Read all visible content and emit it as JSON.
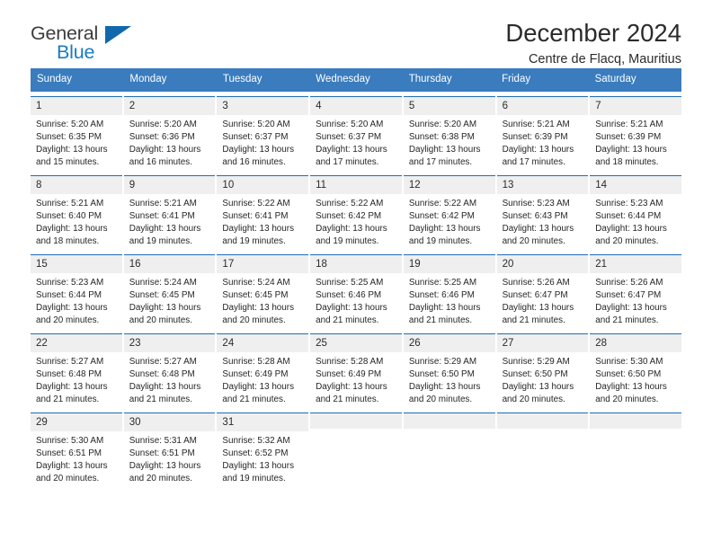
{
  "logo": {
    "word_one": "General",
    "word_two": "Blue",
    "icon": "triangle-mark"
  },
  "header": {
    "title": "December 2024",
    "subtitle": "Centre de Flacq, Mauritius"
  },
  "colors": {
    "header_band": "#3a7cbe",
    "cell_top_border": "#1f6db5",
    "day_number_bg": "#efefef",
    "logo_blue": "#1a7cc0",
    "text": "#262626"
  },
  "calendar": {
    "weekday_headers": [
      "Sunday",
      "Monday",
      "Tuesday",
      "Wednesday",
      "Thursday",
      "Friday",
      "Saturday"
    ],
    "weeks": [
      [
        {
          "day": "1",
          "lines": [
            "Sunrise: 5:20 AM",
            "Sunset: 6:35 PM",
            "Daylight: 13 hours",
            "and 15 minutes."
          ]
        },
        {
          "day": "2",
          "lines": [
            "Sunrise: 5:20 AM",
            "Sunset: 6:36 PM",
            "Daylight: 13 hours",
            "and 16 minutes."
          ]
        },
        {
          "day": "3",
          "lines": [
            "Sunrise: 5:20 AM",
            "Sunset: 6:37 PM",
            "Daylight: 13 hours",
            "and 16 minutes."
          ]
        },
        {
          "day": "4",
          "lines": [
            "Sunrise: 5:20 AM",
            "Sunset: 6:37 PM",
            "Daylight: 13 hours",
            "and 17 minutes."
          ]
        },
        {
          "day": "5",
          "lines": [
            "Sunrise: 5:20 AM",
            "Sunset: 6:38 PM",
            "Daylight: 13 hours",
            "and 17 minutes."
          ]
        },
        {
          "day": "6",
          "lines": [
            "Sunrise: 5:21 AM",
            "Sunset: 6:39 PM",
            "Daylight: 13 hours",
            "and 17 minutes."
          ]
        },
        {
          "day": "7",
          "lines": [
            "Sunrise: 5:21 AM",
            "Sunset: 6:39 PM",
            "Daylight: 13 hours",
            "and 18 minutes."
          ]
        }
      ],
      [
        {
          "day": "8",
          "lines": [
            "Sunrise: 5:21 AM",
            "Sunset: 6:40 PM",
            "Daylight: 13 hours",
            "and 18 minutes."
          ]
        },
        {
          "day": "9",
          "lines": [
            "Sunrise: 5:21 AM",
            "Sunset: 6:41 PM",
            "Daylight: 13 hours",
            "and 19 minutes."
          ]
        },
        {
          "day": "10",
          "lines": [
            "Sunrise: 5:22 AM",
            "Sunset: 6:41 PM",
            "Daylight: 13 hours",
            "and 19 minutes."
          ]
        },
        {
          "day": "11",
          "lines": [
            "Sunrise: 5:22 AM",
            "Sunset: 6:42 PM",
            "Daylight: 13 hours",
            "and 19 minutes."
          ]
        },
        {
          "day": "12",
          "lines": [
            "Sunrise: 5:22 AM",
            "Sunset: 6:42 PM",
            "Daylight: 13 hours",
            "and 19 minutes."
          ]
        },
        {
          "day": "13",
          "lines": [
            "Sunrise: 5:23 AM",
            "Sunset: 6:43 PM",
            "Daylight: 13 hours",
            "and 20 minutes."
          ]
        },
        {
          "day": "14",
          "lines": [
            "Sunrise: 5:23 AM",
            "Sunset: 6:44 PM",
            "Daylight: 13 hours",
            "and 20 minutes."
          ]
        }
      ],
      [
        {
          "day": "15",
          "lines": [
            "Sunrise: 5:23 AM",
            "Sunset: 6:44 PM",
            "Daylight: 13 hours",
            "and 20 minutes."
          ]
        },
        {
          "day": "16",
          "lines": [
            "Sunrise: 5:24 AM",
            "Sunset: 6:45 PM",
            "Daylight: 13 hours",
            "and 20 minutes."
          ]
        },
        {
          "day": "17",
          "lines": [
            "Sunrise: 5:24 AM",
            "Sunset: 6:45 PM",
            "Daylight: 13 hours",
            "and 20 minutes."
          ]
        },
        {
          "day": "18",
          "lines": [
            "Sunrise: 5:25 AM",
            "Sunset: 6:46 PM",
            "Daylight: 13 hours",
            "and 21 minutes."
          ]
        },
        {
          "day": "19",
          "lines": [
            "Sunrise: 5:25 AM",
            "Sunset: 6:46 PM",
            "Daylight: 13 hours",
            "and 21 minutes."
          ]
        },
        {
          "day": "20",
          "lines": [
            "Sunrise: 5:26 AM",
            "Sunset: 6:47 PM",
            "Daylight: 13 hours",
            "and 21 minutes."
          ]
        },
        {
          "day": "21",
          "lines": [
            "Sunrise: 5:26 AM",
            "Sunset: 6:47 PM",
            "Daylight: 13 hours",
            "and 21 minutes."
          ]
        }
      ],
      [
        {
          "day": "22",
          "lines": [
            "Sunrise: 5:27 AM",
            "Sunset: 6:48 PM",
            "Daylight: 13 hours",
            "and 21 minutes."
          ]
        },
        {
          "day": "23",
          "lines": [
            "Sunrise: 5:27 AM",
            "Sunset: 6:48 PM",
            "Daylight: 13 hours",
            "and 21 minutes."
          ]
        },
        {
          "day": "24",
          "lines": [
            "Sunrise: 5:28 AM",
            "Sunset: 6:49 PM",
            "Daylight: 13 hours",
            "and 21 minutes."
          ]
        },
        {
          "day": "25",
          "lines": [
            "Sunrise: 5:28 AM",
            "Sunset: 6:49 PM",
            "Daylight: 13 hours",
            "and 21 minutes."
          ]
        },
        {
          "day": "26",
          "lines": [
            "Sunrise: 5:29 AM",
            "Sunset: 6:50 PM",
            "Daylight: 13 hours",
            "and 20 minutes."
          ]
        },
        {
          "day": "27",
          "lines": [
            "Sunrise: 5:29 AM",
            "Sunset: 6:50 PM",
            "Daylight: 13 hours",
            "and 20 minutes."
          ]
        },
        {
          "day": "28",
          "lines": [
            "Sunrise: 5:30 AM",
            "Sunset: 6:50 PM",
            "Daylight: 13 hours",
            "and 20 minutes."
          ]
        }
      ],
      [
        {
          "day": "29",
          "lines": [
            "Sunrise: 5:30 AM",
            "Sunset: 6:51 PM",
            "Daylight: 13 hours",
            "and 20 minutes."
          ]
        },
        {
          "day": "30",
          "lines": [
            "Sunrise: 5:31 AM",
            "Sunset: 6:51 PM",
            "Daylight: 13 hours",
            "and 20 minutes."
          ]
        },
        {
          "day": "31",
          "lines": [
            "Sunrise: 5:32 AM",
            "Sunset: 6:52 PM",
            "Daylight: 13 hours",
            "and 19 minutes."
          ]
        },
        {
          "day": "",
          "lines": []
        },
        {
          "day": "",
          "lines": []
        },
        {
          "day": "",
          "lines": []
        },
        {
          "day": "",
          "lines": []
        }
      ]
    ]
  }
}
